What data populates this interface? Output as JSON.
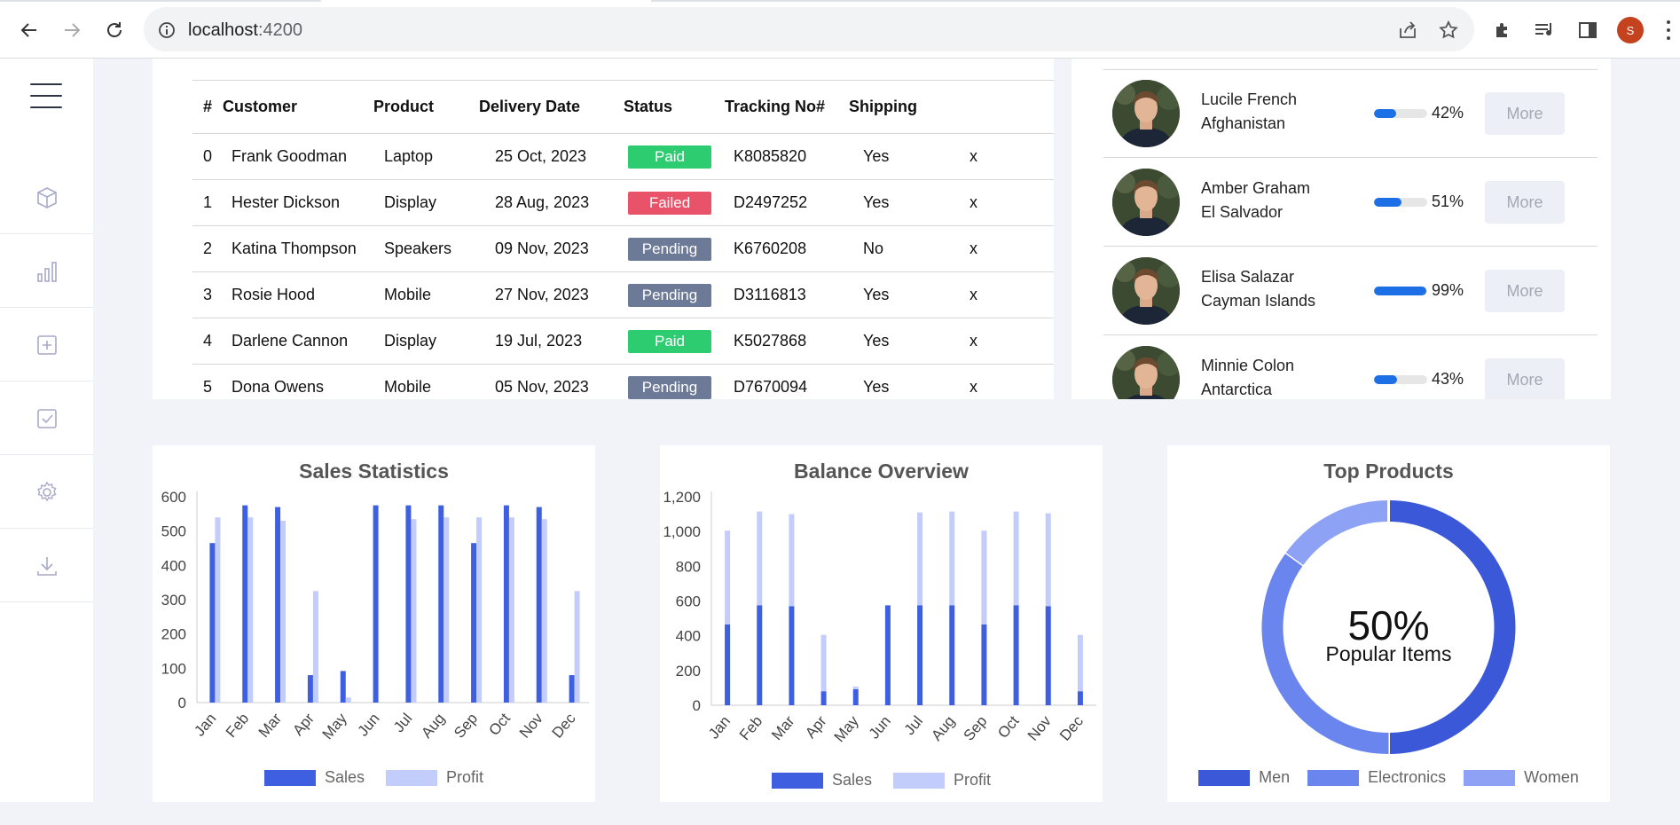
{
  "browser": {
    "url_host": "localhost",
    "url_port": ":4200",
    "profile_initial": "S"
  },
  "sidebar": {
    "items": [
      {
        "icon": "cube-icon"
      },
      {
        "icon": "bar-chart-icon"
      },
      {
        "icon": "plus-square-icon"
      },
      {
        "icon": "check-square-icon"
      },
      {
        "icon": "gear-icon"
      },
      {
        "icon": "download-icon"
      }
    ]
  },
  "orders": {
    "headers": [
      "#",
      "Customer",
      "Product",
      "Delivery Date",
      "Status",
      "Tracking No#",
      "Shipping"
    ],
    "rows": [
      {
        "id": "0",
        "customer": "Frank Goodman",
        "product": "Laptop",
        "date": "25 Oct, 2023",
        "status": "Paid",
        "tracking": "K8085820",
        "shipping": "Yes",
        "action": "x"
      },
      {
        "id": "1",
        "customer": "Hester Dickson",
        "product": "Display",
        "date": "28 Aug, 2023",
        "status": "Failed",
        "tracking": "D2497252",
        "shipping": "Yes",
        "action": "x"
      },
      {
        "id": "2",
        "customer": "Katina Thompson",
        "product": "Speakers",
        "date": "09 Nov, 2023",
        "status": "Pending",
        "tracking": "K6760208",
        "shipping": "No",
        "action": "x"
      },
      {
        "id": "3",
        "customer": "Rosie Hood",
        "product": "Mobile",
        "date": "27 Nov, 2023",
        "status": "Pending",
        "tracking": "D3116813",
        "shipping": "Yes",
        "action": "x"
      },
      {
        "id": "4",
        "customer": "Darlene Cannon",
        "product": "Display",
        "date": "19 Jul, 2023",
        "status": "Paid",
        "tracking": "K5027868",
        "shipping": "Yes",
        "action": "x"
      },
      {
        "id": "5",
        "customer": "Dona Owens",
        "product": "Mobile",
        "date": "05 Nov, 2023",
        "status": "Pending",
        "tracking": "D7670094",
        "shipping": "Yes",
        "action": "x"
      }
    ],
    "status_colors": {
      "Paid": "#2ecc71",
      "Failed": "#e9536a",
      "Pending": "#6c7a97"
    }
  },
  "people": {
    "more_label": "More",
    "items": [
      {
        "name": "Lucile French",
        "country": "Afghanistan",
        "percent_label": "42%",
        "progress": 0.42
      },
      {
        "name": "Amber Graham",
        "country": "El Salvador",
        "percent_label": "51%",
        "progress": 0.51
      },
      {
        "name": "Elisa Salazar",
        "country": "Cayman Islands",
        "percent_label": "99%",
        "progress": 0.99
      },
      {
        "name": "Minnie Colon",
        "country": "Antarctica",
        "percent_label": "43%",
        "progress": 0.43
      }
    ]
  },
  "colors": {
    "sales": "#3e5fe0",
    "profit": "#c3cdfb",
    "men": "#3b58d8",
    "electronics": "#6a86ee",
    "women": "#8ea2f5"
  },
  "chart_data": [
    {
      "type": "bar",
      "title": "Sales Statistics",
      "categories": [
        "Jan",
        "Feb",
        "Mar",
        "Apr",
        "May",
        "Jun",
        "Jul",
        "Aug",
        "Sep",
        "Oct",
        "Nov",
        "Dec"
      ],
      "series": [
        {
          "name": "Sales",
          "values": [
            465,
            575,
            570,
            80,
            92,
            575,
            575,
            575,
            465,
            575,
            570,
            80
          ]
        },
        {
          "name": "Profit",
          "values": [
            540,
            540,
            530,
            325,
            15,
            0,
            535,
            540,
            540,
            540,
            535,
            325
          ]
        }
      ],
      "ylim": [
        0,
        600
      ],
      "yticks": [
        "0",
        "100",
        "200",
        "300",
        "400",
        "500",
        "600"
      ],
      "legend": "bottom"
    },
    {
      "type": "bar",
      "stacked": true,
      "title": "Balance Overview",
      "categories": [
        "Jan",
        "Feb",
        "Mar",
        "Apr",
        "May",
        "Jun",
        "Jul",
        "Aug",
        "Sep",
        "Oct",
        "Nov",
        "Dec"
      ],
      "series": [
        {
          "name": "Sales",
          "values": [
            465,
            575,
            570,
            80,
            92,
            575,
            575,
            575,
            465,
            575,
            570,
            80
          ]
        },
        {
          "name": "Profit",
          "values": [
            540,
            540,
            530,
            325,
            15,
            0,
            535,
            540,
            540,
            540,
            535,
            325
          ]
        }
      ],
      "ylim": [
        0,
        1200
      ],
      "yticks": [
        "0",
        "200",
        "400",
        "600",
        "800",
        "1,000",
        "1,200"
      ],
      "legend": "bottom"
    },
    {
      "type": "pie",
      "donut": true,
      "title": "Top Products",
      "center_value": "50%",
      "center_label": "Popular Items",
      "categories": [
        "Men",
        "Electronics",
        "Women"
      ],
      "values": [
        50,
        35,
        15
      ],
      "legend": "bottom"
    }
  ]
}
